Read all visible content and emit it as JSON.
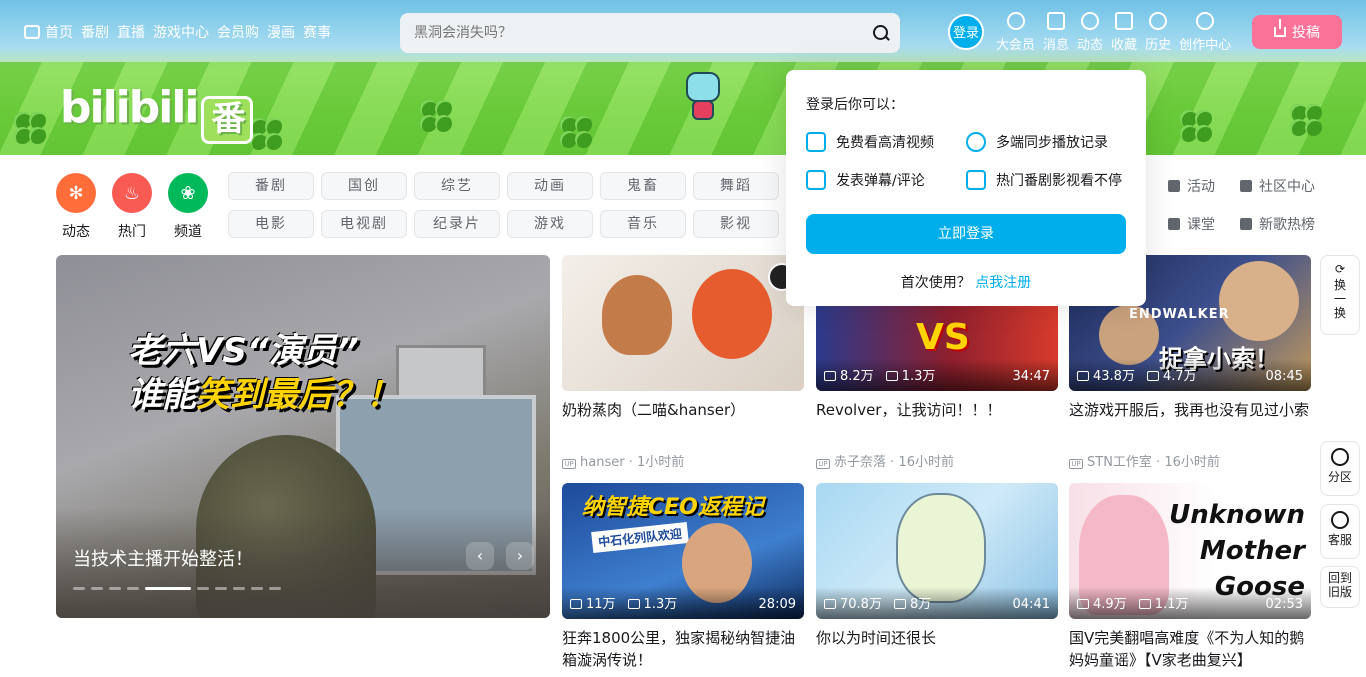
{
  "topnav": {
    "items": [
      "首页",
      "番剧",
      "直播",
      "游戏中心",
      "会员购",
      "漫画",
      "赛事"
    ]
  },
  "search": {
    "placeholder": "黑洞会消失吗？"
  },
  "header": {
    "login_label": "登录",
    "icons": [
      {
        "label": "大会员",
        "icon": "vip-icon"
      },
      {
        "label": "消息",
        "icon": "message-icon"
      },
      {
        "label": "动态",
        "icon": "dynamic-icon"
      },
      {
        "label": "收藏",
        "icon": "star-icon"
      },
      {
        "label": "历史",
        "icon": "history-icon"
      },
      {
        "label": "创作中心",
        "icon": "bulb-icon"
      }
    ],
    "upload_label": "投稿"
  },
  "banner": {
    "logo_text": "bilibili",
    "logo_badge": "番"
  },
  "channels": [
    {
      "label": "动态",
      "color": "#ff6d3a",
      "icon": "pinwheel-icon"
    },
    {
      "label": "热门",
      "color": "#f85a54",
      "icon": "fire-icon"
    },
    {
      "label": "频道",
      "color": "#00b95a",
      "icon": "channel-icon"
    }
  ],
  "categories": [
    "番剧",
    "国创",
    "综艺",
    "动画",
    "鬼畜",
    "舞蹈",
    "电影",
    "电视剧",
    "纪录片",
    "游戏",
    "音乐",
    "影视"
  ],
  "extras": [
    "活动",
    "社区中心",
    "课堂",
    "新歌热榜"
  ],
  "carousel": {
    "caption_line1_a": "老六VS",
    "caption_line1_b": "“演员”",
    "caption_line2_a": "谁能",
    "caption_line2_b": "笑到最后？！",
    "title": "当技术主播开始整活！",
    "prev": "‹",
    "next": "›",
    "active_index": 4,
    "dot_count": 10
  },
  "videos": [
    {
      "title": "奶粉蒸肉（二喵&hanser）",
      "author": "hanser",
      "time": "1小时前",
      "plays": "",
      "likes": "",
      "duration": "",
      "bg": "#e9e3dc"
    },
    {
      "title": "Revolver，让我访问！！！",
      "author": "赤子奈落",
      "time": "16小时前",
      "plays": "8.2万",
      "likes": "1.3万",
      "duration": "34:47",
      "bg": "#7a2f3f"
    },
    {
      "title": "这游戏开服后，我再也没有见过小索",
      "author": "STN工作室",
      "time": "16小时前",
      "plays": "43.8万",
      "likes": "4.7万",
      "duration": "08:45",
      "bg": "#2a3a6e"
    },
    {
      "title": "狂奔1800公里，独家揭秘纳智捷油箱漩涡传说！",
      "author": "",
      "time": "",
      "plays": "11万",
      "likes": "1.3万",
      "duration": "28:09",
      "bg": "#3b6fb2"
    },
    {
      "title": "你以为时间还很长",
      "author": "",
      "time": "",
      "plays": "70.8万",
      "likes": "8万",
      "duration": "04:41",
      "bg": "#9fd0ec"
    },
    {
      "title": "国V完美翻唱高难度《不为人知的鹅妈妈童谣》【V家老曲复兴】",
      "author": "",
      "time": "",
      "plays": "4.9万",
      "likes": "1.1万",
      "duration": "02:53",
      "bg": "#f2e6ea"
    }
  ],
  "thumb_text": {
    "v2": "VS",
    "v3": "捉拿小索！",
    "v3_top": "ENDWALKER",
    "v4": "纳智捷CEO返程记",
    "v4_sub": "中石化列队欢迎",
    "v6": "Unknown Mother Goose"
  },
  "popover": {
    "heading": "登录后你可以：",
    "features": [
      "免费看高清视频",
      "多端同步播放记录",
      "发表弹幕/评论",
      "热门番剧影视看不停"
    ],
    "login_button": "立即登录",
    "first_time": "首次使用？",
    "register_link": "点我注册"
  },
  "sidebar": {
    "refresh": "换一换",
    "zone": "分区",
    "service": "客服",
    "old": "回到旧版"
  }
}
